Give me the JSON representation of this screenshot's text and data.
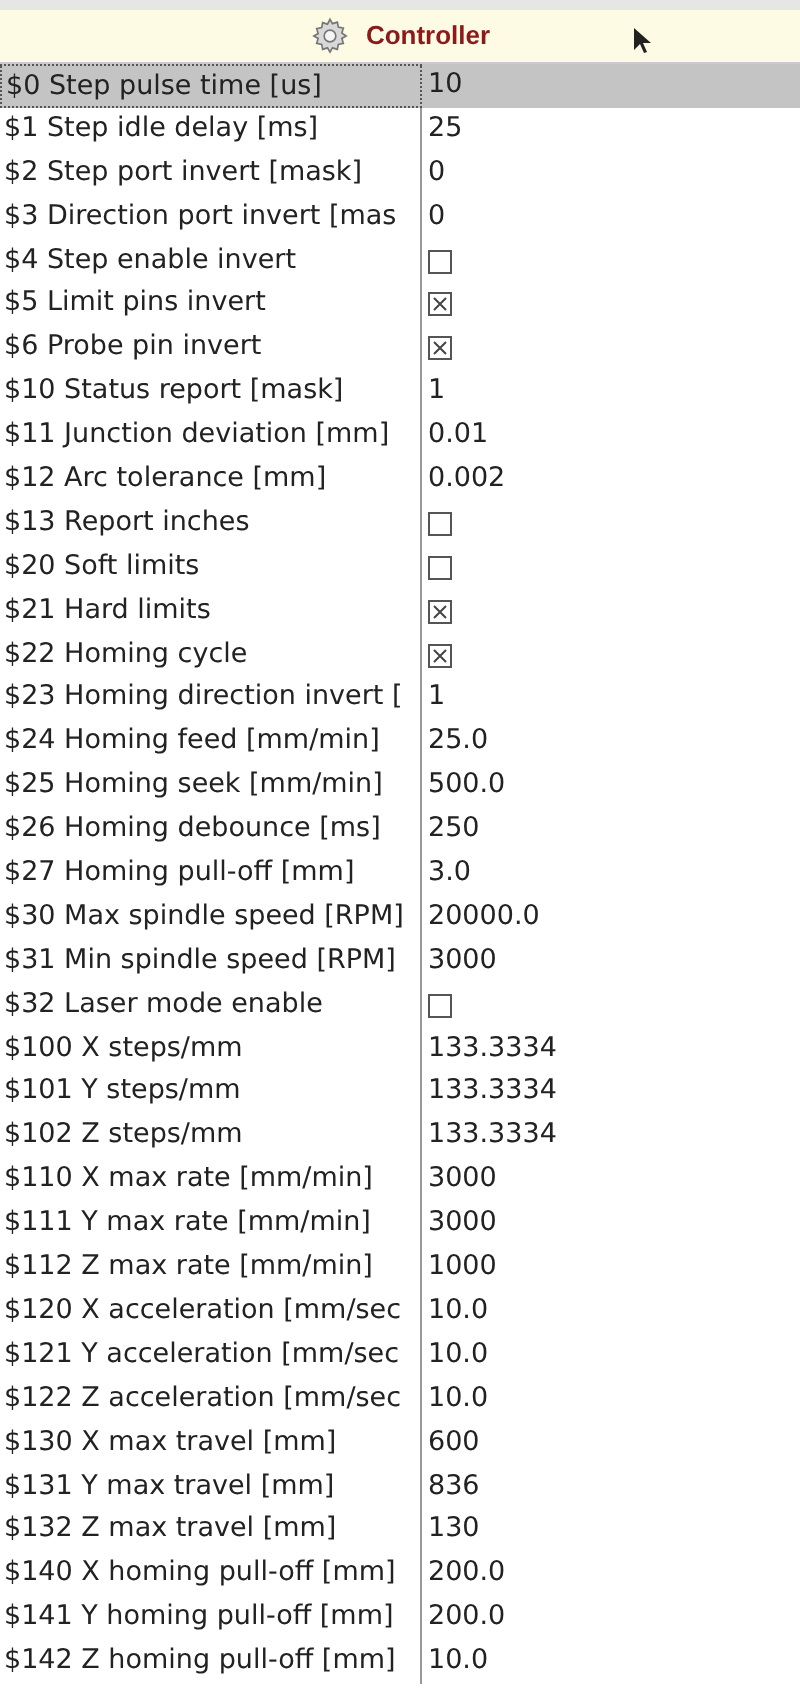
{
  "header": {
    "title": "Controller"
  },
  "settings": [
    {
      "label": "$0 Step pulse time [us]",
      "kind": "text",
      "value": "10",
      "selected": true
    },
    {
      "label": "$1 Step idle delay [ms]",
      "kind": "text",
      "value": "25",
      "selected": false
    },
    {
      "label": "$2 Step port invert [mask]",
      "kind": "text",
      "value": "0",
      "selected": false
    },
    {
      "label": "$3 Direction port invert [mas",
      "kind": "text",
      "value": "0",
      "selected": false
    },
    {
      "label": "$4 Step enable invert",
      "kind": "checkbox",
      "checked": false,
      "selected": false
    },
    {
      "label": "$5 Limit pins invert",
      "kind": "checkbox",
      "checked": true,
      "selected": false
    },
    {
      "label": "$6 Probe pin invert",
      "kind": "checkbox",
      "checked": true,
      "selected": false
    },
    {
      "label": "$10 Status report [mask]",
      "kind": "text",
      "value": "1",
      "selected": false
    },
    {
      "label": "$11 Junction deviation [mm]",
      "kind": "text",
      "value": "0.01",
      "selected": false
    },
    {
      "label": "$12 Arc tolerance [mm]",
      "kind": "text",
      "value": "0.002",
      "selected": false
    },
    {
      "label": "$13 Report inches",
      "kind": "checkbox",
      "checked": false,
      "selected": false
    },
    {
      "label": "$20 Soft limits",
      "kind": "checkbox",
      "checked": false,
      "selected": false
    },
    {
      "label": "$21 Hard limits",
      "kind": "checkbox",
      "checked": true,
      "selected": false
    },
    {
      "label": "$22 Homing cycle",
      "kind": "checkbox",
      "checked": true,
      "selected": false
    },
    {
      "label": "$23 Homing direction invert [",
      "kind": "text",
      "value": "1",
      "selected": false
    },
    {
      "label": "$24 Homing feed [mm/min]",
      "kind": "text",
      "value": "25.0",
      "selected": false
    },
    {
      "label": "$25 Homing seek [mm/min]",
      "kind": "text",
      "value": "500.0",
      "selected": false
    },
    {
      "label": "$26 Homing debounce [ms]",
      "kind": "text",
      "value": "250",
      "selected": false
    },
    {
      "label": "$27 Homing pull-off [mm]",
      "kind": "text",
      "value": "3.0",
      "selected": false
    },
    {
      "label": "$30 Max spindle speed [RPM]",
      "kind": "text",
      "value": "20000.0",
      "selected": false
    },
    {
      "label": "$31 Min spindle speed [RPM]",
      "kind": "text",
      "value": "3000",
      "selected": false
    },
    {
      "label": "$32 Laser mode enable",
      "kind": "checkbox",
      "checked": false,
      "selected": false
    },
    {
      "label": "$100 X steps/mm",
      "kind": "text",
      "value": "133.3334",
      "selected": false
    },
    {
      "label": "$101 Y steps/mm",
      "kind": "text",
      "value": "133.3334",
      "selected": false
    },
    {
      "label": "$102 Z steps/mm",
      "kind": "text",
      "value": "133.3334",
      "selected": false
    },
    {
      "label": "$110 X max rate [mm/min]",
      "kind": "text",
      "value": "3000",
      "selected": false
    },
    {
      "label": "$111 Y max rate [mm/min]",
      "kind": "text",
      "value": "3000",
      "selected": false
    },
    {
      "label": "$112 Z max rate [mm/min]",
      "kind": "text",
      "value": "1000",
      "selected": false
    },
    {
      "label": "$120 X acceleration [mm/sec",
      "kind": "text",
      "value": "10.0",
      "selected": false
    },
    {
      "label": "$121 Y acceleration [mm/sec",
      "kind": "text",
      "value": "10.0",
      "selected": false
    },
    {
      "label": "$122 Z acceleration [mm/sec",
      "kind": "text",
      "value": "10.0",
      "selected": false
    },
    {
      "label": "$130 X max travel [mm]",
      "kind": "text",
      "value": "600",
      "selected": false
    },
    {
      "label": "$131 Y max travel [mm]",
      "kind": "text",
      "value": "836",
      "selected": false
    },
    {
      "label": "$132 Z max travel [mm]",
      "kind": "text",
      "value": "130",
      "selected": false
    },
    {
      "label": "$140 X homing pull-off [mm]",
      "kind": "text",
      "value": "200.0",
      "selected": false
    },
    {
      "label": "$141 Y homing pull-off [mm]",
      "kind": "text",
      "value": "200.0",
      "selected": false
    },
    {
      "label": "$142 Z homing pull-off [mm]",
      "kind": "text",
      "value": "10.0",
      "selected": false
    }
  ]
}
